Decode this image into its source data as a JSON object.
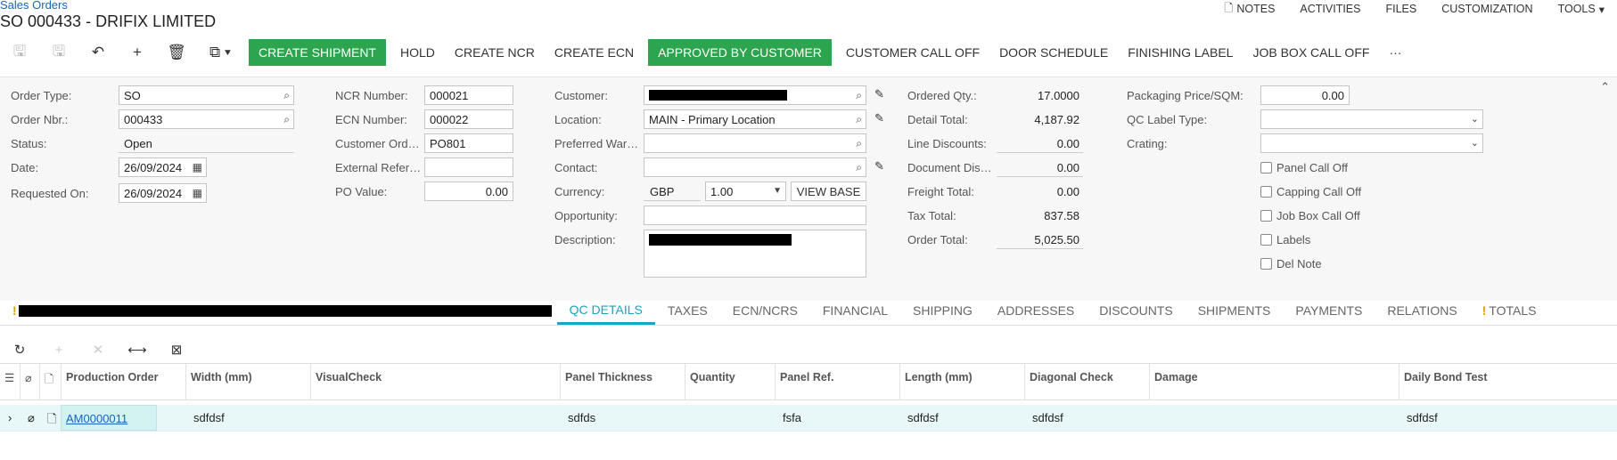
{
  "breadcrumb": "Sales Orders",
  "title": "SO 000433 - DRIFIX LIMITED",
  "top_menu": [
    "NOTES",
    "ACTIVITIES",
    "FILES",
    "CUSTOMIZATION",
    "TOOLS"
  ],
  "toolbar": {
    "buttons": [
      "CREATE SHIPMENT",
      "HOLD",
      "CREATE NCR",
      "CREATE ECN",
      "APPROVED BY CUSTOMER",
      "CUSTOMER CALL OFF",
      "DOOR SCHEDULE",
      "FINISHING LABEL",
      "JOB BOX CALL OFF"
    ],
    "more": "···"
  },
  "col1": {
    "order_type_label": "Order Type:",
    "order_type": "SO",
    "order_nbr_label": "Order Nbr.:",
    "order_nbr": "000433",
    "status_label": "Status:",
    "status": "Open",
    "date_label": "Date:",
    "date": "26/09/2024",
    "requested_label": "Requested On:",
    "requested": "26/09/2024"
  },
  "col2": {
    "ncr_label": "NCR Number:",
    "ncr": "000021",
    "ecn_label": "ECN Number:",
    "ecn": "000022",
    "cust_ord_label": "Customer Ord…",
    "cust_ord": "PO801",
    "ext_ref_label": "External Refer…",
    "ext_ref": "",
    "po_value_label": "PO Value:",
    "po_value": "0.00"
  },
  "col3": {
    "customer_label": "Customer:",
    "location_label": "Location:",
    "location": "MAIN - Primary Location",
    "pref_war_label": "Preferred War…",
    "contact_label": "Contact:",
    "currency_label": "Currency:",
    "currency": "GBP",
    "rate": "1.00",
    "view_base": "VIEW BASE",
    "opportunity_label": "Opportunity:",
    "description_label": "Description:"
  },
  "col4": {
    "ordered_qty_label": "Ordered Qty.:",
    "ordered_qty": "17.0000",
    "detail_total_label": "Detail Total:",
    "detail_total": "4,187.92",
    "line_disc_label": "Line Discounts:",
    "line_disc": "0.00",
    "doc_disc_label": "Document Dis…",
    "doc_disc": "0.00",
    "freight_label": "Freight Total:",
    "freight": "0.00",
    "tax_label": "Tax Total:",
    "tax": "837.58",
    "order_total_label": "Order Total:",
    "order_total": "5,025.50"
  },
  "col5": {
    "pack_price_label": "Packaging Price/SQM:",
    "pack_price": "0.00",
    "qc_label_type_label": "QC Label Type:",
    "crating_label": "Crating:",
    "checks": [
      "Panel Call Off",
      "Capping Call Off",
      "Job Box Call Off",
      "Labels",
      "Del Note"
    ]
  },
  "tabs": [
    "QC DETAILS",
    "TAXES",
    "ECN/NCRS",
    "FINANCIAL",
    "SHIPPING",
    "ADDRESSES",
    "DISCOUNTS",
    "SHIPMENTS",
    "PAYMENTS",
    "RELATIONS",
    "TOTALS"
  ],
  "grid": {
    "columns": [
      "Production Order",
      "Width (mm)",
      "VisualCheck",
      "Panel Thickness",
      "Quantity",
      "Panel Ref.",
      "Length (mm)",
      "Diagonal Check",
      "Damage",
      "Daily Bond Test"
    ],
    "rows": [
      {
        "production_order": "AM0000011",
        "width": "sdfdsf",
        "visual": "",
        "thickness": "sdfds",
        "quantity": "",
        "panel_ref": "fsfa",
        "length": "sdfdsf",
        "diagonal": "sdfdsf",
        "damage": "",
        "bond": "sdfdsf"
      }
    ]
  }
}
